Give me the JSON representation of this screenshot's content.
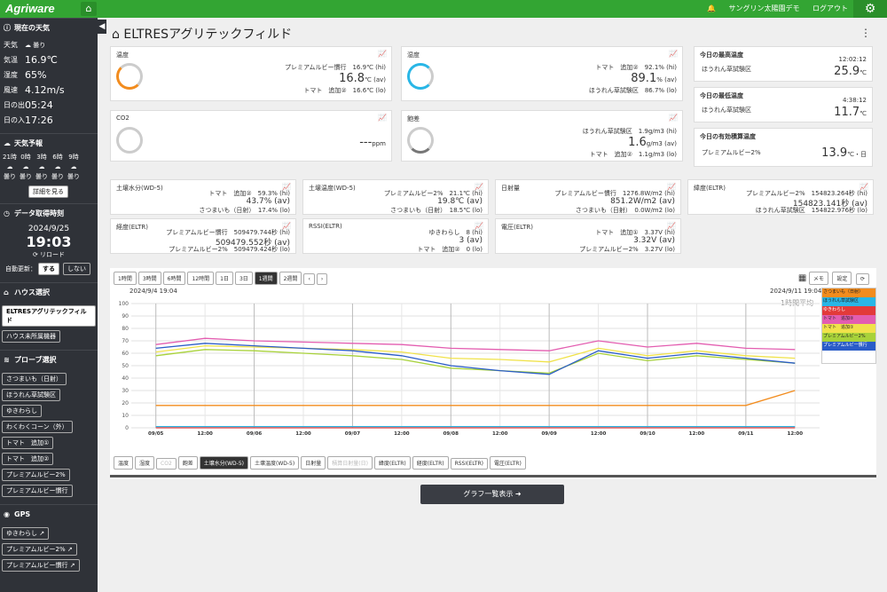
{
  "header": {
    "logo": "Agriware",
    "user": "サングリン太陽園デモ",
    "logout": "ログアウト"
  },
  "sidebar": {
    "weather_title": "現在の天気",
    "weather": [
      {
        "k": "天気",
        "v": "曇り"
      },
      {
        "k": "気温",
        "v": "16.9℃"
      },
      {
        "k": "湿度",
        "v": "65%"
      },
      {
        "k": "風速",
        "v": "4.12m/s"
      },
      {
        "k": "日の出",
        "v": "05:24"
      },
      {
        "k": "日の入",
        "v": "17:26"
      }
    ],
    "forecast_title": "天気予報",
    "forecast": [
      {
        "t": "21時",
        "w": "曇り"
      },
      {
        "t": "0時",
        "w": "曇り"
      },
      {
        "t": "3時",
        "w": "曇り"
      },
      {
        "t": "6時",
        "w": "曇り"
      },
      {
        "t": "9時",
        "w": "曇り"
      }
    ],
    "detail_btn": "詳細を見る",
    "data_title": "データ取得時刻",
    "date": "2024/9/25",
    "time": "19:03",
    "reload": "リロード",
    "auto": "自動更新：",
    "auto_on": "する",
    "auto_off": "しない",
    "house_title": "ハウス選択",
    "houses": [
      "ELTRESアグリテックフィルド",
      "ハウス未所属機器"
    ],
    "probe_title": "プローブ選択",
    "probes": [
      "さつまいも（日射）",
      "ほうれん草試験区",
      "ゆきわらし",
      "わくわくコーン（外）",
      "トマト　追加①",
      "トマト　追加②",
      "プレミアムルビー2%",
      "プレミアムルビー慣行"
    ],
    "gps_title": "GPS",
    "gps": [
      "ゆきわらし",
      "プレミアムルビー2%",
      "プレミアムルビー慣行"
    ]
  },
  "main": {
    "title": "ELTRESアグリテックフィルド",
    "temp": {
      "title": "温度",
      "r1": "プレミアムルビー慣行　16.9℃ (hi)",
      "big": "16.8",
      "unit": "℃ (av)",
      "r3": "トマト　追加②　16.6℃ (lo)"
    },
    "hum": {
      "title": "湿度",
      "r1": "トマト　追加②　92.1% (hi)",
      "big": "89.1",
      "unit": "% (av)",
      "r3": "ほうれん草試験区　86.7% (lo)"
    },
    "co2": {
      "title": "CO2",
      "big": "---",
      "unit": "ppm"
    },
    "sat": {
      "title": "飽差",
      "r1": "ほうれん草試験区　1.9g/m3 (hi)",
      "big": "1.6",
      "unit": "g/m3 (av)",
      "r3": "トマト　追加②　1.1g/m3 (lo)"
    },
    "maxT": {
      "title": "今日の最高温度",
      "time": "12:02:12",
      "name": "ほうれん草試験区",
      "val": "25.9",
      "unit": "℃"
    },
    "minT": {
      "title": "今日の最低温度",
      "time": "4:38:12",
      "name": "ほうれん草試験区",
      "val": "11.7",
      "unit": "℃"
    },
    "acc": {
      "title": "今日の有効積算温度",
      "name": "プレミアムルビー2%",
      "val": "13.9",
      "unit": "℃・日"
    },
    "soil": {
      "title": "土壌水分(WD-5)",
      "r1": "トマト　追加②　59.3% (hi)",
      "r2": "43.7% (av)",
      "r3": "さつまいも（日射）　17.4% (lo)"
    },
    "soilT": {
      "title": "土壌温度(WD-5)",
      "r1": "プレミアムルビー2%　21.1℃ (hi)",
      "r2": "19.8℃ (av)",
      "r3": "さつまいも（日射）　18.5℃ (lo)"
    },
    "sun": {
      "title": "日射量",
      "r1": "プレミアムルビー慣行　1276.8W/m2 (hi)",
      "r2": "851.2W/m2 (av)",
      "r3": "さつまいも（日射）　0.0W/m2 (lo)"
    },
    "lat": {
      "title": "緯度(ELTR)",
      "r1": "プレミアムルビー2%　154823.264秒 (hi)",
      "r2": "154823.141秒 (av)",
      "r3": "ほうれん草試験区　154822.976秒 (lo)"
    },
    "lon": {
      "title": "経度(ELTR)",
      "r1": "プレミアムルビー慣行　509479.744秒 (hi)",
      "r2": "509479.552秒 (av)",
      "r3": "プレミアムルビー2%　509479.424秒 (lo)"
    },
    "rssi": {
      "title": "RSSI(ELTR)",
      "r1": "ゆきわらし　8 (hi)",
      "r2": "3 (av)",
      "r3": "トマト　追加②　0 (lo)"
    },
    "volt": {
      "title": "電圧(ELTR)",
      "r1": "トマト　追加①　3.37V (hi)",
      "r2": "3.32V (av)",
      "r3": "プレミアムルビー2%　3.27V (lo)"
    },
    "range_btns": [
      "1時間",
      "3時間",
      "6時間",
      "12時間",
      "1日",
      "3日",
      "1週間",
      "2週間"
    ],
    "memo": "メモ",
    "setting": "設定",
    "start": "2024/9/4 19:04",
    "end": "2024/9/11 19:04",
    "avg": "1時間平均",
    "metric_tabs": [
      "温度",
      "湿度",
      "CO2",
      "飽差",
      "土壌水分(WD-5)",
      "土壌温度(WD-5)",
      "日射量",
      "積算日射量(日)",
      "緯度(ELTR)",
      "経度(ELTR)",
      "RSSI(ELTR)",
      "電圧(ELTR)"
    ],
    "list_btn": "グラフ一覧表示"
  },
  "chart_data": {
    "type": "line",
    "ylim": [
      0,
      100
    ],
    "yticks": [
      0,
      10,
      20,
      30,
      40,
      50,
      60,
      70,
      80,
      90,
      100
    ],
    "x": [
      "09/05",
      "12:00",
      "09/06",
      "12:00",
      "09/07",
      "12:00",
      "09/08",
      "12:00",
      "09/09",
      "12:00",
      "09/10",
      "12:00",
      "09/11",
      "12:00"
    ],
    "series": [
      {
        "name": "さつまいも（日射）",
        "color": "#f28c1e",
        "values": [
          18,
          18,
          18,
          18,
          18,
          18,
          18,
          18,
          18,
          18,
          18,
          18,
          18,
          30
        ]
      },
      {
        "name": "ほうれん草試験区",
        "color": "#29b6e6",
        "values": [
          1,
          1,
          1,
          1,
          1,
          1,
          1,
          1,
          1,
          1,
          1,
          1,
          1,
          1
        ]
      },
      {
        "name": "ゆきわらし",
        "color": "#e23a3a",
        "values": [
          0,
          0,
          0,
          0,
          0,
          0,
          0,
          0,
          0,
          0,
          0,
          0,
          0,
          0
        ]
      },
      {
        "name": "トマト　追加②",
        "color": "#e35db0",
        "values": [
          67,
          72,
          70,
          69,
          68,
          67,
          64,
          63,
          62,
          70,
          65,
          68,
          64,
          63
        ]
      },
      {
        "name": "トマト　追加①",
        "color": "#f0e24a",
        "values": [
          61,
          66,
          65,
          64,
          63,
          61,
          56,
          55,
          53,
          64,
          58,
          62,
          58,
          56
        ]
      },
      {
        "name": "プレミアムルビー2%",
        "color": "#a8d23a",
        "values": [
          58,
          63,
          62,
          60,
          58,
          55,
          48,
          46,
          44,
          60,
          54,
          58,
          55,
          52
        ]
      },
      {
        "name": "プレミアムルビー慣行",
        "color": "#2a5cc8",
        "values": [
          64,
          68,
          66,
          64,
          62,
          58,
          50,
          46,
          43,
          62,
          56,
          60,
          56,
          52
        ]
      }
    ]
  }
}
